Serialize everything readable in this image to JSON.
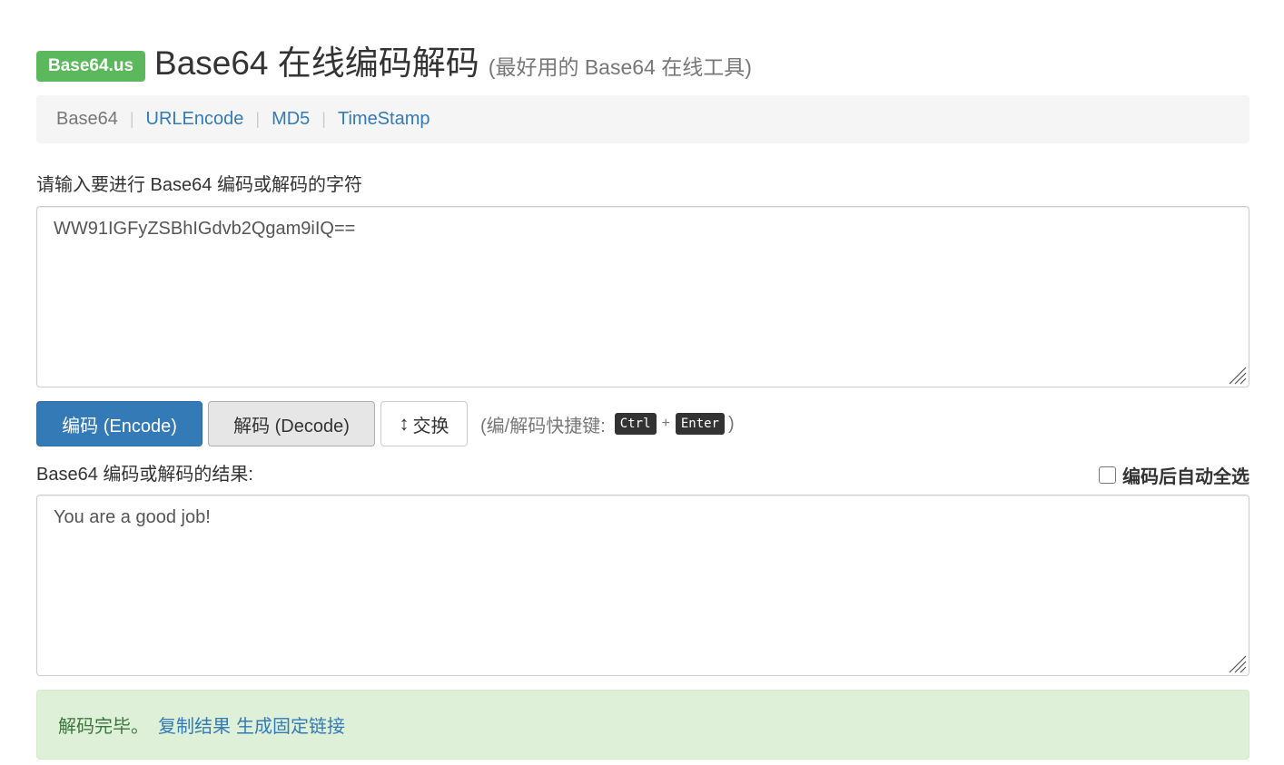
{
  "header": {
    "badge": "Base64.us",
    "title": "Base64 在线编码解码",
    "subtitle": "(最好用的 Base64 在线工具)"
  },
  "nav": {
    "items": [
      {
        "label": "Base64",
        "active": true
      },
      {
        "label": "URLEncode",
        "active": false
      },
      {
        "label": "MD5",
        "active": false
      },
      {
        "label": "TimeStamp",
        "active": false
      }
    ],
    "separator": "|"
  },
  "input": {
    "label": "请输入要进行 Base64 编码或解码的字符",
    "value": "WW91IGFyZSBhIGdvb2Qgam9iIQ=="
  },
  "buttons": {
    "encode": "编码 (Encode)",
    "decode": "解码 (Decode)",
    "swap": "交换",
    "swap_icon": "↕"
  },
  "shortcut": {
    "prefix": "(编/解码快捷键:",
    "key1": "Ctrl",
    "plus": "+",
    "key2": "Enter",
    "suffix": ")"
  },
  "output": {
    "label": "Base64 编码或解码的结果:",
    "value": "You are a good job!",
    "autoselect_label": "编码后自动全选",
    "autoselect_checked": false
  },
  "alert": {
    "status": "解码完毕。",
    "copy_link": "复制结果",
    "permalink": "生成固定链接"
  },
  "colors": {
    "badge": "#5cb85c",
    "primary": "#337ab7",
    "alert_bg": "#dff0d8",
    "alert_text": "#3c763d"
  }
}
